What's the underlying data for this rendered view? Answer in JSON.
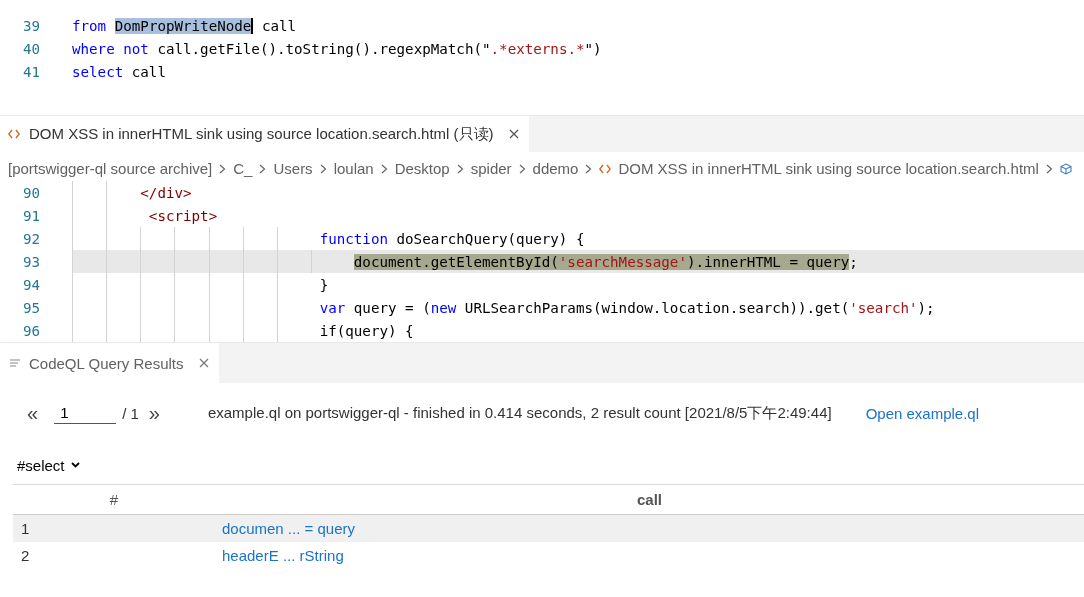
{
  "query_editor": {
    "lines": [
      {
        "number": "39",
        "tokens": [
          {
            "text": "from ",
            "kind": "keyword"
          },
          {
            "text": "DomPropWriteNode",
            "kind": "selected"
          },
          {
            "text": " call",
            "kind": "plain"
          }
        ]
      },
      {
        "number": "40",
        "tokens": [
          {
            "text": "where ",
            "kind": "keyword"
          },
          {
            "text": "not",
            "kind": "keyword"
          },
          {
            "text": " call.getFile().toString().regexpMatch(\"",
            "kind": "plain"
          },
          {
            "text": ".*externs.*",
            "kind": "string"
          },
          {
            "text": "\")",
            "kind": "plain"
          }
        ]
      },
      {
        "number": "41",
        "tokens": [
          {
            "text": "select",
            "kind": "keyword"
          },
          {
            "text": " call",
            "kind": "plain"
          }
        ]
      }
    ]
  },
  "source_editor": {
    "tab": {
      "title": "DOM XSS in innerHTML sink using source location.search.html (只读)",
      "selected": true
    },
    "breadcrumb": [
      {
        "label": "[portswigger-ql source archive]",
        "kind": "text"
      },
      {
        "label": "C_",
        "kind": "text"
      },
      {
        "label": "Users",
        "kind": "text"
      },
      {
        "label": "loulan",
        "kind": "text"
      },
      {
        "label": "Desktop",
        "kind": "text"
      },
      {
        "label": "spider",
        "kind": "text"
      },
      {
        "label": "ddemo",
        "kind": "text"
      },
      {
        "label": "DOM XSS in innerHTML sink using source location.search.html",
        "kind": "file"
      }
    ],
    "lines": [
      {
        "number": "90",
        "current": false,
        "tokens": [
          {
            "text": "        </div>",
            "kind": "tag"
          }
        ]
      },
      {
        "number": "91",
        "current": false,
        "tokens": [
          {
            "text": "         <script>",
            "kind": "tag"
          }
        ]
      },
      {
        "number": "92",
        "current": false,
        "tokens": [
          {
            "text": "                             function",
            "kind": "keyword"
          },
          {
            "text": " doSearchQuery(query) {",
            "kind": "plain"
          }
        ]
      },
      {
        "number": "93",
        "current": true,
        "tokens": [
          {
            "text": "                                 document.getElementById(",
            "kind": "match"
          },
          {
            "text": "'searchMessage'",
            "kind": "match-string"
          },
          {
            "text": ").innerHTML = query",
            "kind": "match"
          },
          {
            "text": ";",
            "kind": "plain"
          }
        ]
      },
      {
        "number": "94",
        "current": false,
        "tokens": [
          {
            "text": "                             }",
            "kind": "plain"
          }
        ]
      },
      {
        "number": "95",
        "current": false,
        "tokens": [
          {
            "text": "                             var",
            "kind": "keyword"
          },
          {
            "text": " query = (",
            "kind": "plain"
          },
          {
            "text": "new",
            "kind": "keyword"
          },
          {
            "text": " URLSearchParams(window.location.search)).get(",
            "kind": "plain"
          },
          {
            "text": "'search'",
            "kind": "string"
          },
          {
            "text": ");",
            "kind": "plain"
          }
        ]
      },
      {
        "number": "96",
        "current": false,
        "tokens": [
          {
            "text": "                             if(query) {",
            "kind": "plain"
          }
        ]
      }
    ]
  },
  "results": {
    "tab": {
      "title": "CodeQL Query Results",
      "selected": true
    },
    "pager": {
      "first": "«",
      "page": "1",
      "total": "/ 1",
      "last": "»"
    },
    "summary": "example.ql on portswigger-ql - finished in 0.414 seconds, 2 result count [2021/8/5下午2:49:44]",
    "open_link": "Open example.ql",
    "result_set": "#select",
    "table": {
      "columns": [
        "#",
        "call"
      ],
      "rows": [
        {
          "index": "1",
          "call": "documen ... = query",
          "selected": true
        },
        {
          "index": "2",
          "call": "headerE ... rString",
          "selected": false
        }
      ]
    }
  }
}
